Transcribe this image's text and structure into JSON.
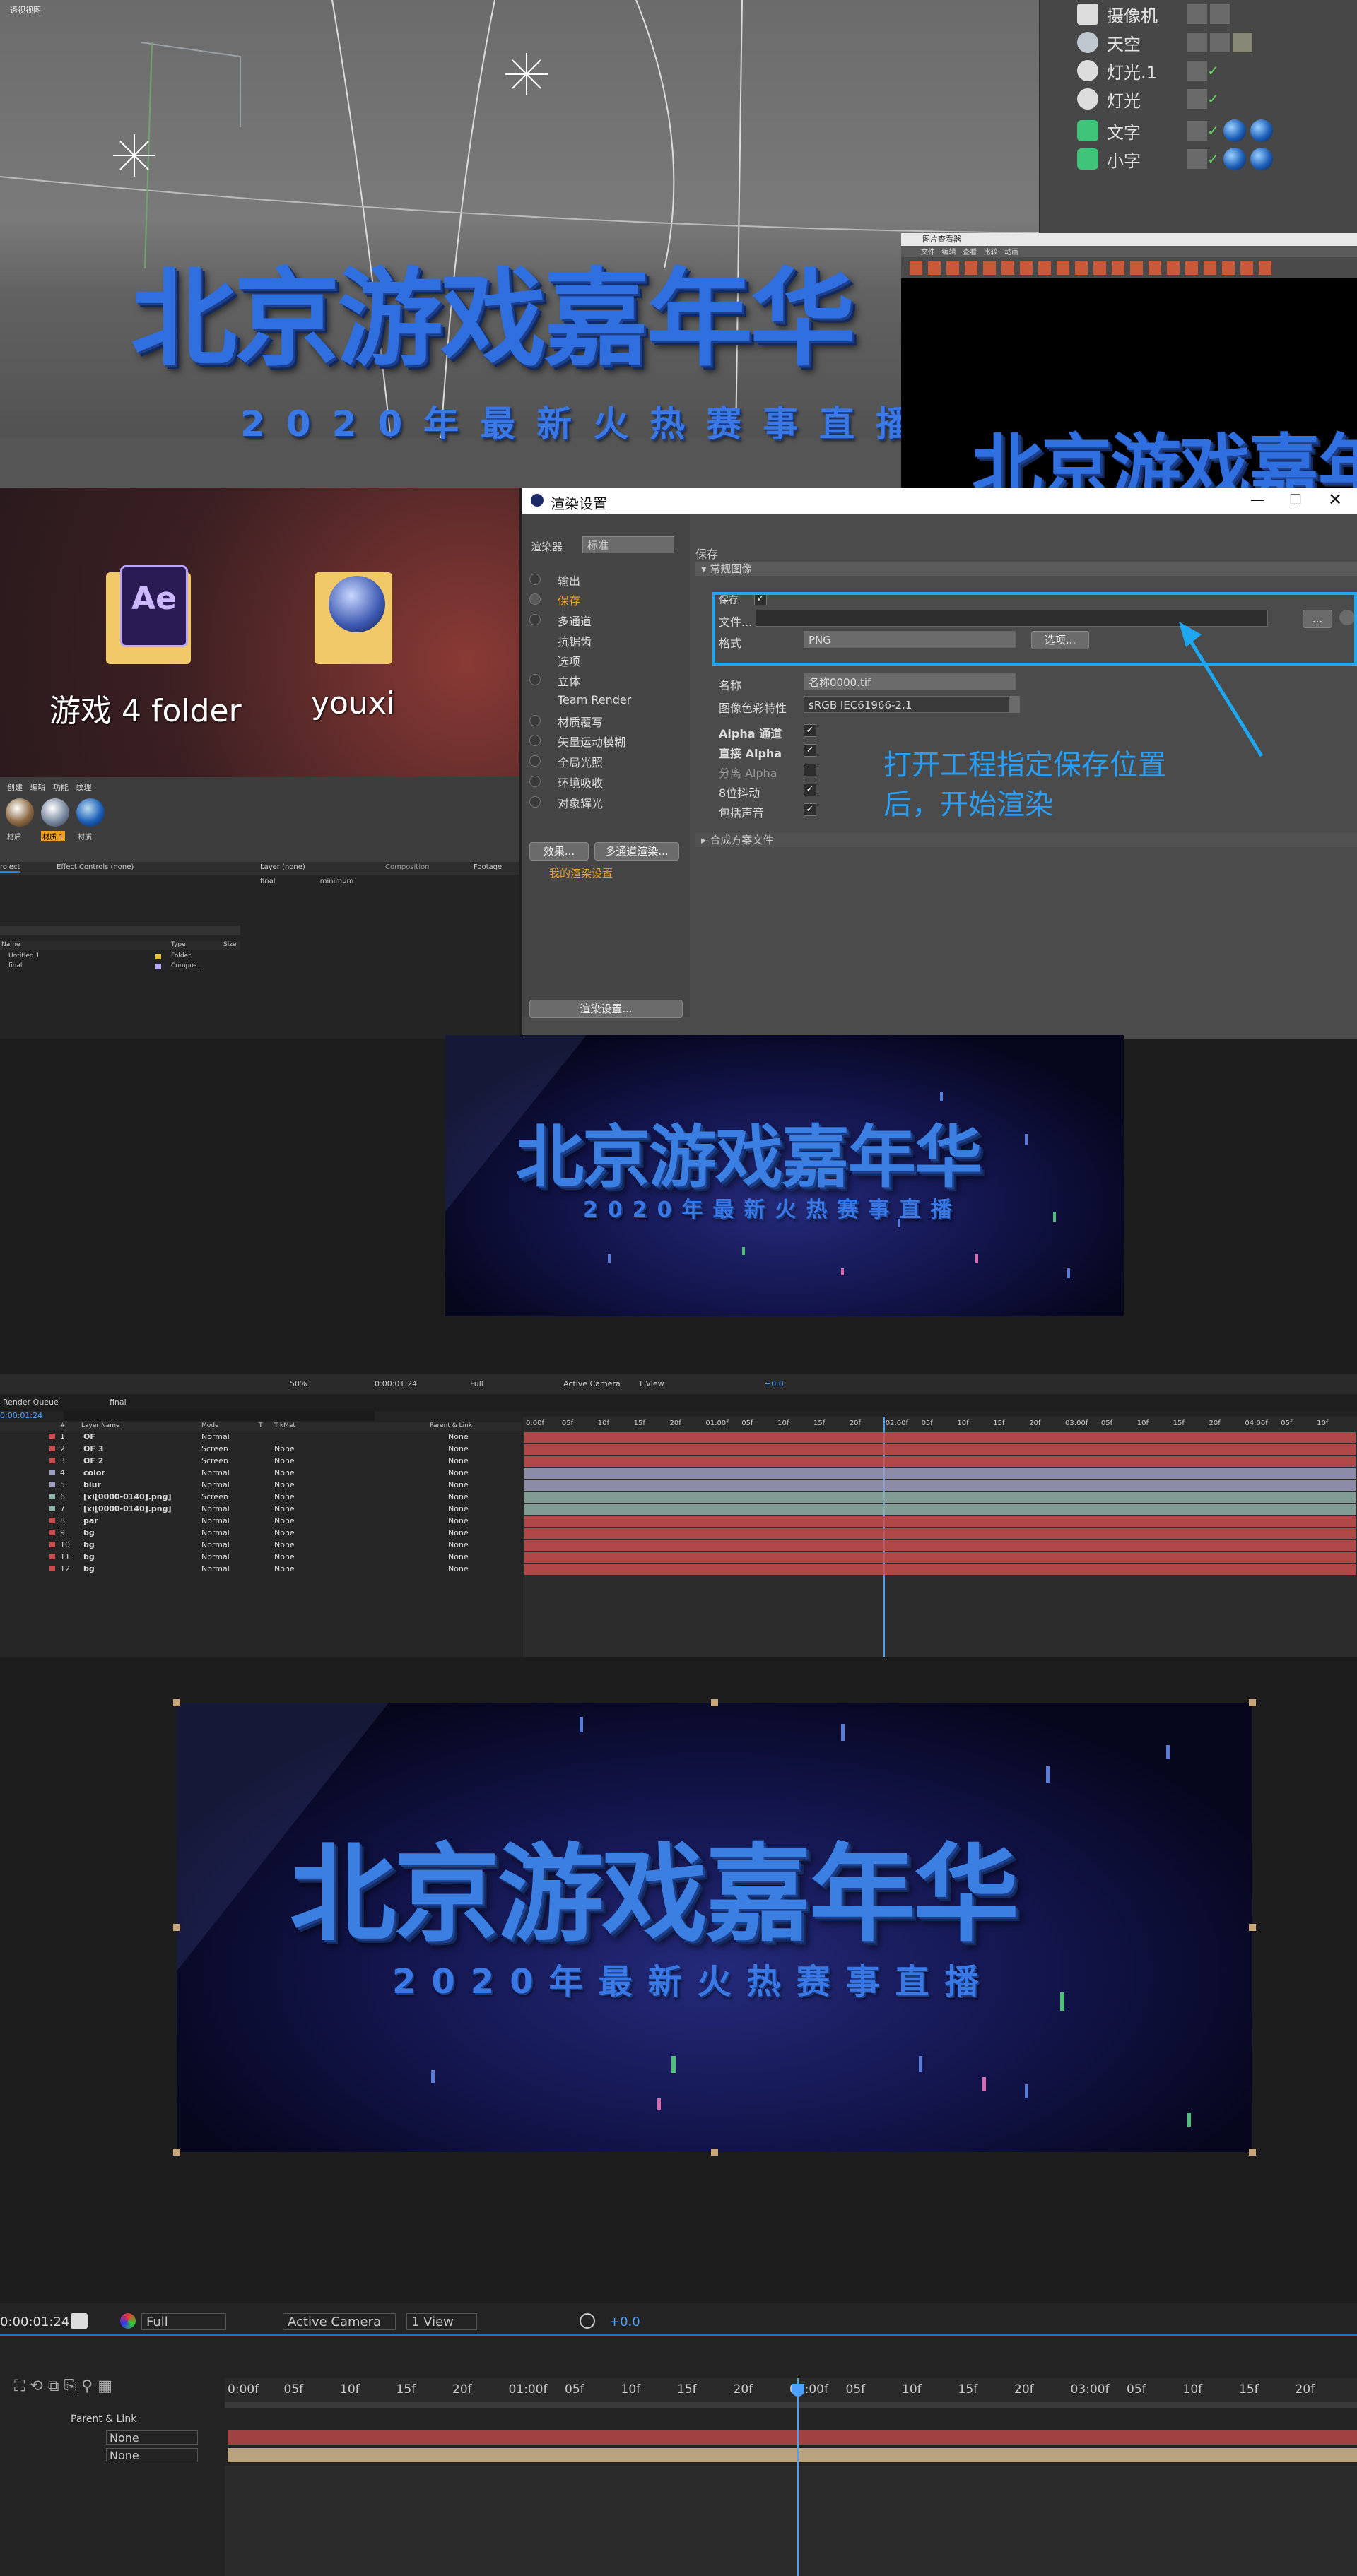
{
  "c4d": {
    "viewport_label": "透视视图",
    "title_text": "北京游戏嘉年华",
    "subtitle_text": "2020年最新火热赛事直播",
    "objects": [
      {
        "name": "摄像机"
      },
      {
        "name": "天空"
      },
      {
        "name": "灯光.1"
      },
      {
        "name": "灯光"
      },
      {
        "name": "文字"
      },
      {
        "name": "小字"
      }
    ],
    "picture_viewer": {
      "title": "图片查看器",
      "menu": [
        "文件",
        "编辑",
        "查看",
        "比较",
        "动画"
      ]
    }
  },
  "desktop": {
    "icons": [
      {
        "label": "游戏 4 folder",
        "badge": "Ae"
      },
      {
        "label": "youxi"
      }
    ],
    "material_menu": [
      "创建",
      "编辑",
      "功能",
      "纹理"
    ],
    "materials": [
      "材质",
      "材质.1",
      "材质"
    ]
  },
  "ae_left": {
    "tabs": [
      "roject",
      "Effect Controls (none)"
    ],
    "layer_tab": "Layer (none)",
    "comp_tab": "Composition",
    "footage_tab": "Footage",
    "flow": [
      "final",
      "minimum"
    ],
    "columns": [
      "Name",
      "Type",
      "Size"
    ],
    "items": [
      {
        "name": "Untitled 1",
        "type": "Folder"
      },
      {
        "name": "final",
        "type": "Compos..."
      }
    ]
  },
  "render_settings": {
    "title": "渲染设置",
    "renderer_label": "渲染器",
    "renderer_value": "标准",
    "left_items": [
      {
        "label": "输出",
        "checked": false
      },
      {
        "label": "保存",
        "checked": true,
        "active": true
      },
      {
        "label": "多通道",
        "checked": false
      },
      {
        "label": "抗锯齿",
        "checked": false
      },
      {
        "label": "选项",
        "checked": false
      },
      {
        "label": "立体",
        "checked": false
      },
      {
        "label": "Team Render",
        "checked": false
      },
      {
        "label": "材质覆写",
        "checked": false
      },
      {
        "label": "矢量运动模糊",
        "checked": false
      },
      {
        "label": "全局光照",
        "checked": false
      },
      {
        "label": "环境吸收",
        "checked": false
      },
      {
        "label": "对象辉光",
        "checked": false
      }
    ],
    "effects_button": "效果...",
    "multipass_button": "多通道渲染...",
    "preset_name": "我的渲染设置",
    "bottom_button": "渲染设置...",
    "section_title": "保存",
    "subsection": "常规图像",
    "save_label": "保存",
    "file_label": "文件...",
    "format_label": "格式",
    "format_value": "PNG",
    "options_button": "选项...",
    "name_label": "名称",
    "name_value": "名称0000.tif",
    "color_profile_label": "图像色彩特性",
    "color_profile_value": "sRGB IEC61966-2.1",
    "alpha_label": "Alpha 通道",
    "straight_alpha_label": "直接 Alpha",
    "separate_alpha_label": "分离 Alpha",
    "dither_label": "8位抖动",
    "include_sound_label": "包括声音",
    "comp_file_label": "合成方案文件",
    "browse_button": "...",
    "annotation": [
      "打开工程指定保存位置",
      "后，开始渲染"
    ]
  },
  "scene": {
    "title": "北京游戏嘉年华",
    "subtitle": "2020年最新火热赛事直播"
  },
  "ae_timeline": {
    "viewer_bar": {
      "zoom": "50%",
      "time": "0:00:01:24",
      "quality": "Full",
      "camera": "Active Camera",
      "view": "1 View",
      "offset": "+0.0"
    },
    "tabs": [
      "Render Queue",
      "final"
    ],
    "current_time": "0:00:01:24",
    "columns": [
      "#",
      "Layer Name",
      "Mode",
      "T",
      "TrkMat",
      "Parent & Link"
    ],
    "layers": [
      {
        "num": "1",
        "name": "OF",
        "mode": "Normal",
        "trk": "",
        "color": "#c94d4d"
      },
      {
        "num": "2",
        "name": "OF 3",
        "mode": "Screen",
        "trk": "None",
        "color": "#c94d4d"
      },
      {
        "num": "3",
        "name": "OF 2",
        "mode": "Screen",
        "trk": "None",
        "color": "#c94d4d"
      },
      {
        "num": "4",
        "name": "color",
        "mode": "Normal",
        "trk": "None",
        "color": "#9e9ec0"
      },
      {
        "num": "5",
        "name": "blur",
        "mode": "Normal",
        "trk": "None",
        "color": "#9e9ec0"
      },
      {
        "num": "6",
        "name": "[xi[0000-0140].png]",
        "mode": "Screen",
        "trk": "None",
        "color": "#8fb0a8"
      },
      {
        "num": "7",
        "name": "[xi[0000-0140].png]",
        "mode": "Normal",
        "trk": "None",
        "color": "#8fb0a8"
      },
      {
        "num": "8",
        "name": "par",
        "mode": "Normal",
        "trk": "None",
        "color": "#c94d4d"
      },
      {
        "num": "9",
        "name": "bg",
        "mode": "Normal",
        "trk": "None",
        "color": "#c94d4d"
      },
      {
        "num": "10",
        "name": "bg",
        "mode": "Normal",
        "trk": "None",
        "color": "#c94d4d"
      },
      {
        "num": "11",
        "name": "bg",
        "mode": "Normal",
        "trk": "None",
        "color": "#c94d4d"
      },
      {
        "num": "12",
        "name": "bg",
        "mode": "Normal",
        "trk": "None",
        "color": "#c94d4d"
      }
    ],
    "none_label": "None",
    "ruler": [
      "0:00f",
      "05f",
      "10f",
      "15f",
      "20f",
      "01:00f",
      "05f",
      "10f",
      "15f",
      "20f",
      "02:00f",
      "05f",
      "10f",
      "15f",
      "20f",
      "03:00f",
      "05f",
      "10f",
      "15f",
      "20f",
      "04:00f",
      "05f",
      "10f"
    ]
  },
  "bottom": {
    "time": "0:00:01:24",
    "quality": "Full",
    "camera": "Active Camera",
    "view": "1 View",
    "offset": "+0.0",
    "parent_link": "Parent & Link",
    "rows": [
      "None",
      "None"
    ],
    "ruler": [
      "0:00f",
      "05f",
      "10f",
      "15f",
      "20f",
      "01:00f",
      "05f",
      "10f",
      "15f",
      "20f",
      "02:00f",
      "05f",
      "10f",
      "15f",
      "20f",
      "03:00f",
      "05f",
      "10f",
      "15f",
      "20f"
    ]
  },
  "colors": {
    "accent": "#1ea7f0",
    "title_blue": "#2f6fe0",
    "annotation": "#2a9df4",
    "active_item": "#f0a020"
  }
}
